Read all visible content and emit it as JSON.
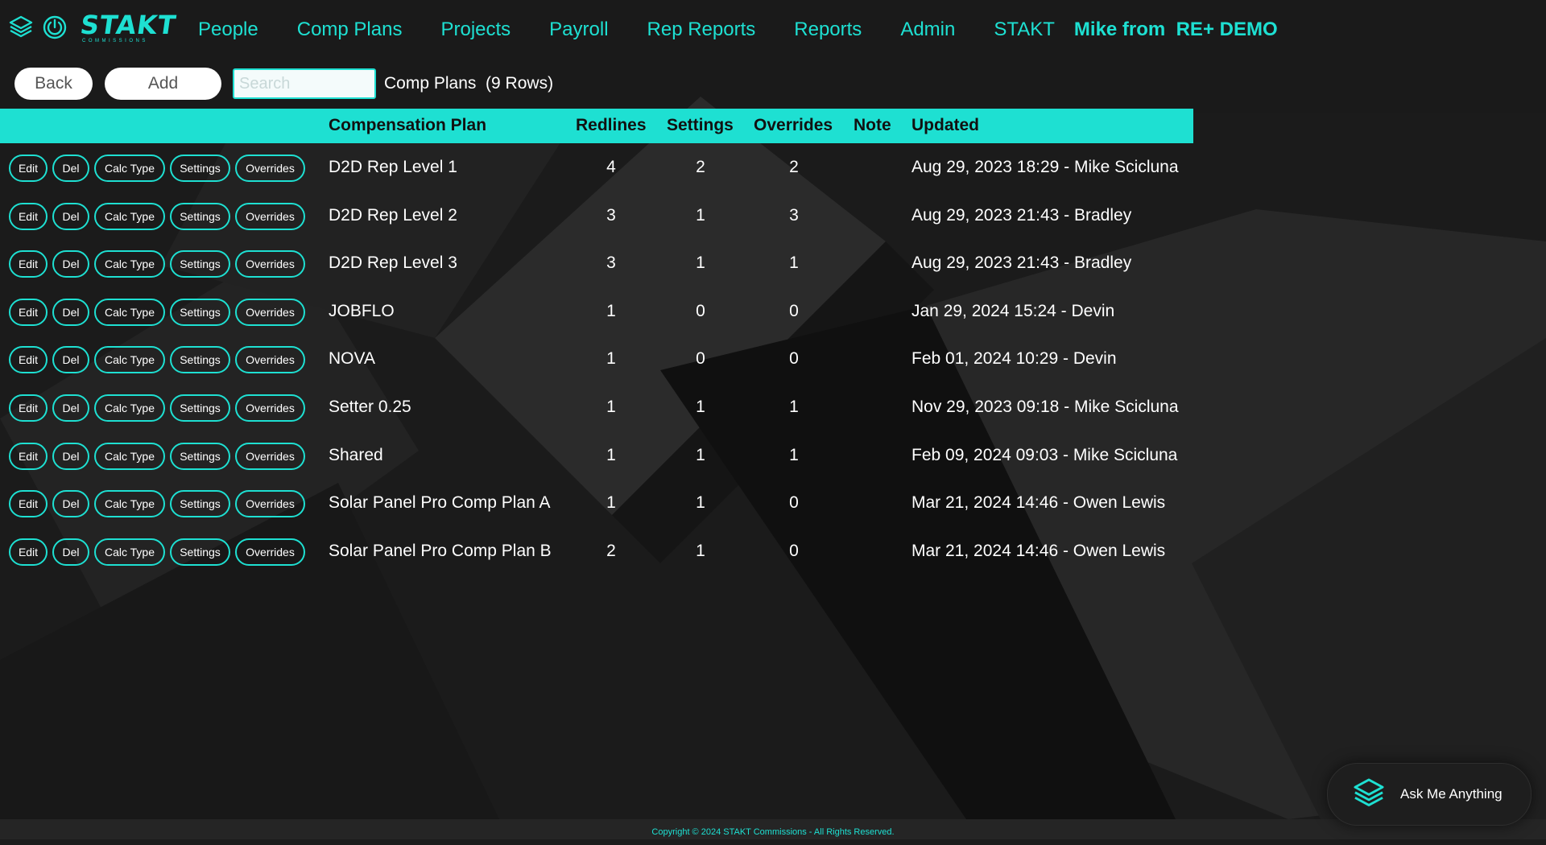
{
  "colors": {
    "accent": "#1ee0d2",
    "background": "#1c1c1c"
  },
  "brand": {
    "name": "STAKT",
    "tagline": "COMMISSIONS",
    "logo_icon": "stack-layers-icon",
    "power_icon": "power-icon"
  },
  "nav": {
    "items": [
      "People",
      "Comp Plans",
      "Projects",
      "Payroll",
      "Rep Reports",
      "Reports",
      "Admin",
      "STAKT"
    ],
    "user_label": "Mike from  RE+ DEMO"
  },
  "toolbar": {
    "back_label": "Back",
    "add_label": "Add",
    "search_placeholder": "Search",
    "search_value": "",
    "page_heading": "Comp Plans  (9 Rows)"
  },
  "table": {
    "columns": [
      "Compensation Plan",
      "Redlines",
      "Settings",
      "Overrides",
      "Note",
      "Updated"
    ],
    "row_actions": [
      "Edit",
      "Del",
      "Calc Type",
      "Settings",
      "Overrides"
    ],
    "rows": [
      {
        "plan": "D2D Rep Level 1",
        "redlines": "4",
        "settings": "2",
        "overrides": "2",
        "note": "",
        "updated": "Aug 29, 2023 18:29 - Mike Scicluna"
      },
      {
        "plan": "D2D Rep Level 2",
        "redlines": "3",
        "settings": "1",
        "overrides": "3",
        "note": "",
        "updated": "Aug 29, 2023 21:43 - Bradley"
      },
      {
        "plan": "D2D Rep Level 3",
        "redlines": "3",
        "settings": "1",
        "overrides": "1",
        "note": "",
        "updated": "Aug 29, 2023 21:43 - Bradley"
      },
      {
        "plan": "JOBFLO",
        "redlines": "1",
        "settings": "0",
        "overrides": "0",
        "note": "",
        "updated": "Jan 29, 2024 15:24 - Devin"
      },
      {
        "plan": "NOVA",
        "redlines": "1",
        "settings": "0",
        "overrides": "0",
        "note": "",
        "updated": "Feb 01, 2024 10:29 - Devin"
      },
      {
        "plan": "Setter 0.25",
        "redlines": "1",
        "settings": "1",
        "overrides": "1",
        "note": "",
        "updated": "Nov 29, 2023 09:18 - Mike Scicluna"
      },
      {
        "plan": "Shared",
        "redlines": "1",
        "settings": "1",
        "overrides": "1",
        "note": "",
        "updated": "Feb 09, 2024 09:03 - Mike Scicluna"
      },
      {
        "plan": "Solar Panel Pro Comp Plan A",
        "redlines": "1",
        "settings": "1",
        "overrides": "0",
        "note": "",
        "updated": "Mar 21, 2024 14:46 - Owen Lewis"
      },
      {
        "plan": "Solar Panel Pro Comp Plan B",
        "redlines": "2",
        "settings": "1",
        "overrides": "0",
        "note": "",
        "updated": "Mar 21, 2024 14:46 - Owen Lewis"
      }
    ]
  },
  "assistant": {
    "label": "Ask Me Anything",
    "icon": "stack-layers-icon"
  },
  "footer": {
    "copyright": "Copyright © 2024 STAKT Commissions - All Rights Reserved."
  }
}
